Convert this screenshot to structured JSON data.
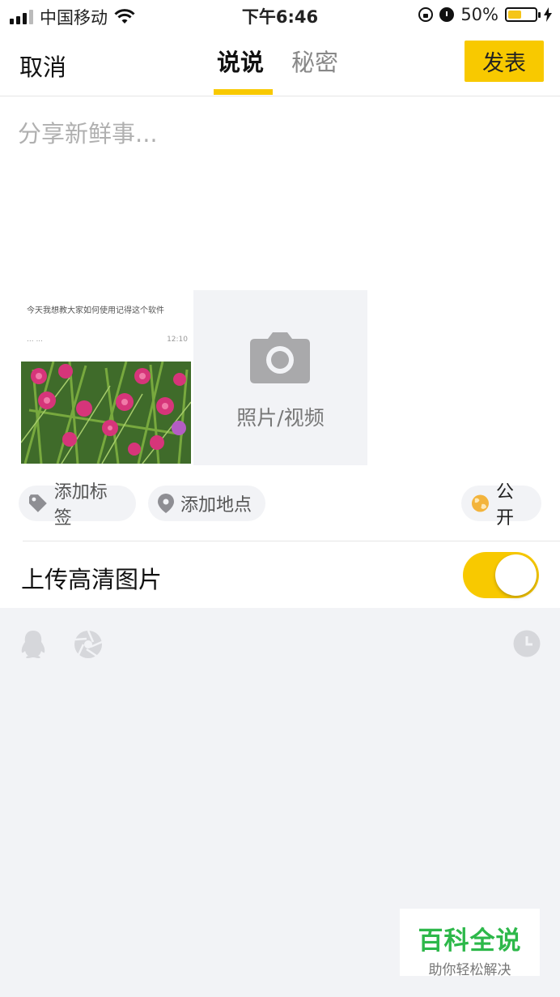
{
  "status_bar": {
    "carrier": "中国移动",
    "time": "下午6:46",
    "battery_percent": "50%",
    "battery_level": 0.5,
    "icons": [
      "signal-icon",
      "wifi-icon",
      "rotation-lock-icon",
      "alarm-icon",
      "battery-icon",
      "charging-icon"
    ]
  },
  "nav": {
    "cancel_label": "取消",
    "tabs": [
      {
        "label": "说说",
        "active": true
      },
      {
        "label": "秘密",
        "active": false
      }
    ],
    "publish_label": "发表"
  },
  "composer": {
    "placeholder": "分享新鲜事..."
  },
  "media": {
    "thumbnail": {
      "caption": "今天我想教大家如何使用记得这个软件",
      "ellipsis": "... ...",
      "time": "12:10"
    },
    "add_label": "照片/视频"
  },
  "chips": {
    "tag_label": "添加标签",
    "location_label": "添加地点",
    "privacy_label": "公开"
  },
  "hd_upload": {
    "label": "上传高清图片",
    "enabled": true
  },
  "toolbar_icons": [
    "qq-icon",
    "shutter-icon",
    "clock-icon"
  ],
  "watermark": {
    "title": "百科全说",
    "subtitle": "助你轻松解决"
  },
  "colors": {
    "accent": "#f8c900",
    "panel_bg": "#f2f3f6",
    "watermark_green": "#2db84a"
  }
}
